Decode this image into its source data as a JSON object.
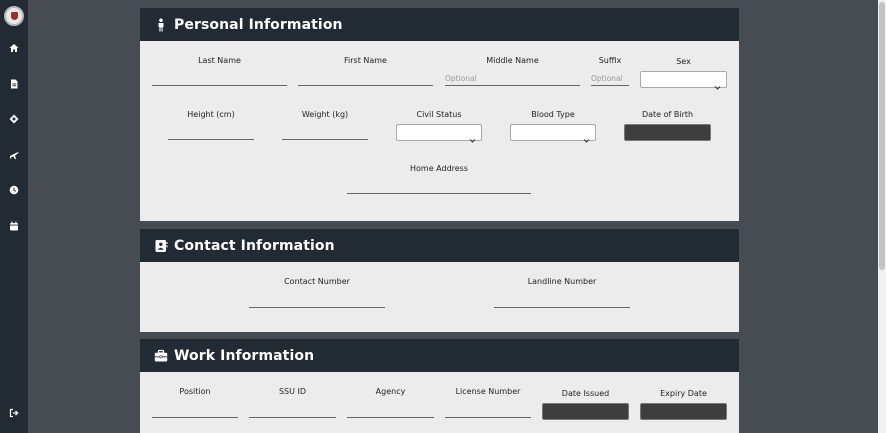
{
  "sidebar": {
    "icons": [
      "home-icon",
      "document-icon",
      "diamond-pin-icon",
      "plane-icon",
      "clock-icon",
      "calendar-icon"
    ],
    "logout_icon": "logout-icon"
  },
  "personal": {
    "title": "Personal Information",
    "last_name_label": "Last Name",
    "first_name_label": "First Name",
    "middle_name_label": "Middle Name",
    "middle_name_placeholder": "Optional",
    "suffix_label": "Suffix",
    "suffix_placeholder": "Optional",
    "sex_label": "Sex",
    "height_label": "Height (cm)",
    "weight_label": "Weight (kg)",
    "civil_status_label": "Civil Status",
    "blood_type_label": "Blood Type",
    "dob_label": "Date of Birth",
    "home_address_label": "Home Address"
  },
  "contact": {
    "title": "Contact Information",
    "contact_number_label": "Contact Number",
    "landline_number_label": "Landline Number"
  },
  "work": {
    "title": "Work Information",
    "position_label": "Position",
    "ssu_id_label": "SSU ID",
    "agency_label": "Agency",
    "license_number_label": "License Number",
    "date_issued_label": "Date Issued",
    "expiry_date_label": "Expiry Date"
  },
  "colors": {
    "sidebar": "#222a33",
    "background": "#474b52",
    "card_body": "#ececec",
    "date_box": "#3e3e3e"
  }
}
